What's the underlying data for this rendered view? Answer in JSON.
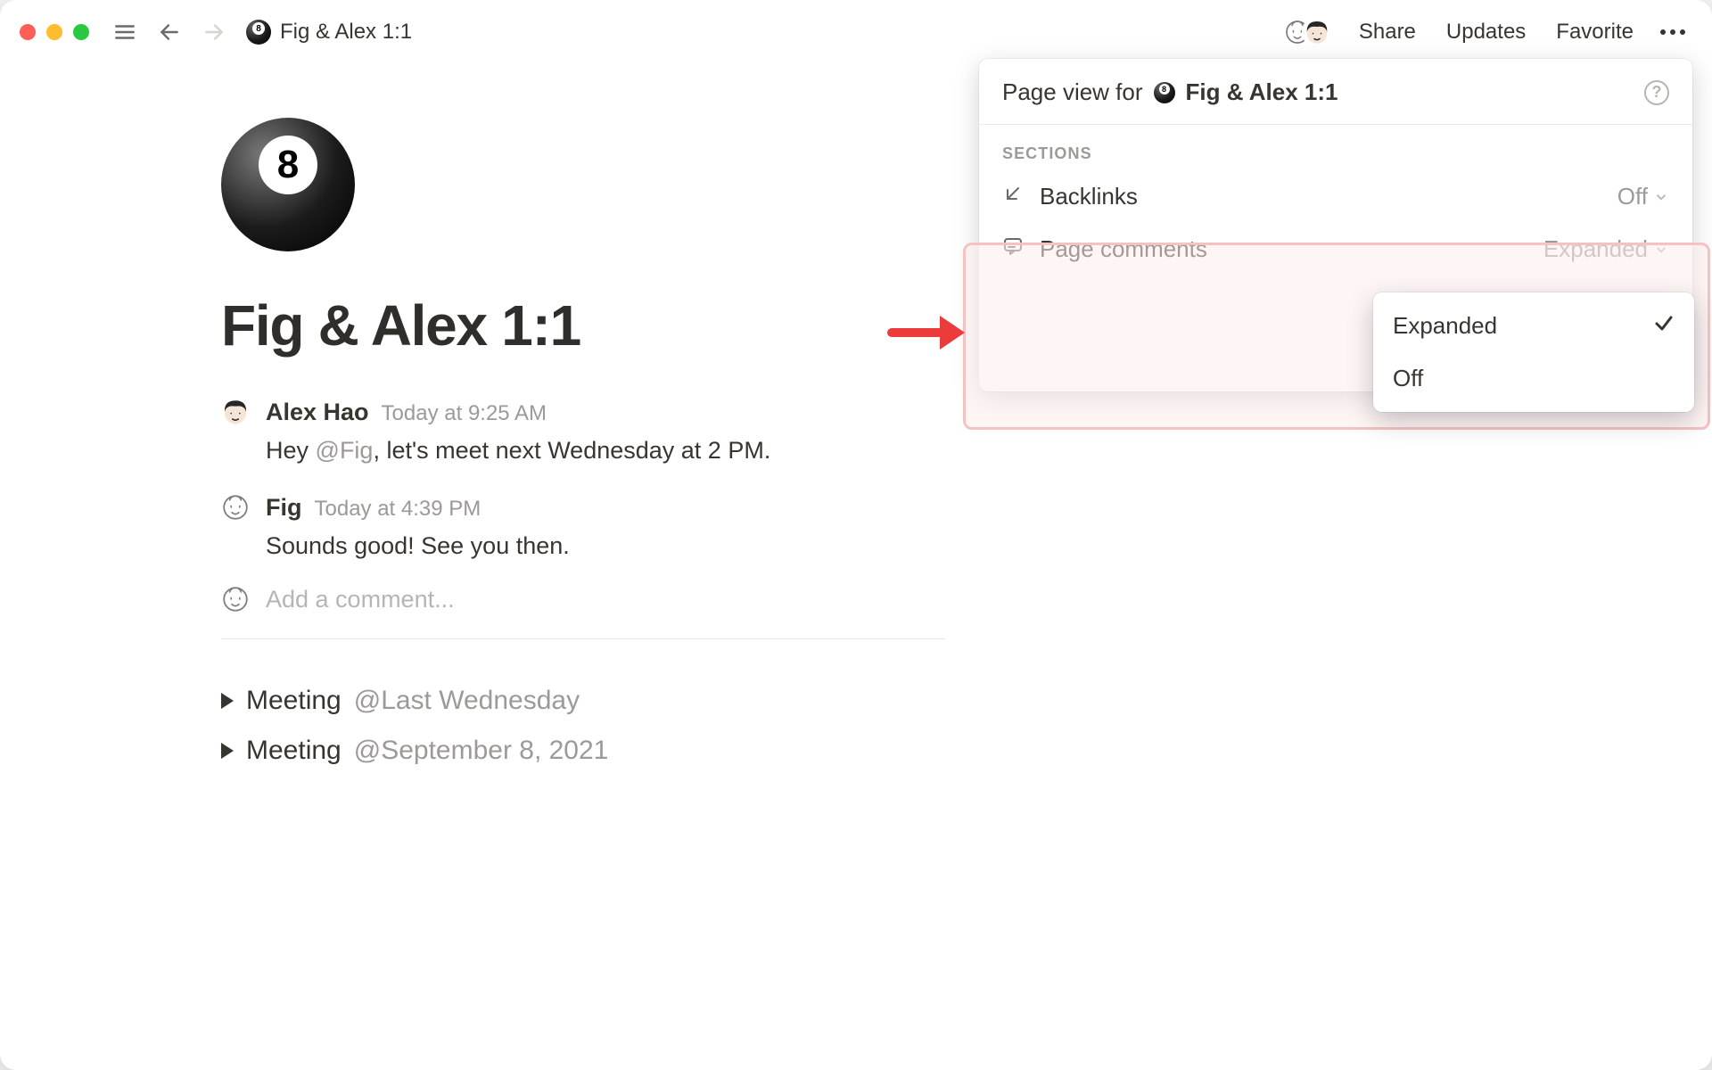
{
  "topbar": {
    "breadcrumb_title": "Fig & Alex 1:1",
    "links": {
      "share": "Share",
      "updates": "Updates",
      "favorite": "Favorite"
    }
  },
  "page": {
    "title": "Fig & Alex 1:1",
    "comments": [
      {
        "author": "Alex Hao",
        "time": "Today at 9:25 AM",
        "text_prefix": "Hey ",
        "mention": "@Fig",
        "text_suffix": ", let's meet next Wednesday at 2 PM."
      },
      {
        "author": "Fig",
        "time": "Today at 4:39 PM",
        "text": "Sounds good! See you then."
      }
    ],
    "add_comment_placeholder": "Add a comment...",
    "toggles": [
      {
        "label": "Meeting",
        "date": "@Last Wednesday"
      },
      {
        "label": "Meeting",
        "date": "@September 8, 2021"
      }
    ]
  },
  "panel": {
    "lead": "Page view for",
    "page_name": "Fig & Alex 1:1",
    "sections_label": "SECTIONS",
    "rows": {
      "backlinks": {
        "label": "Backlinks",
        "value": "Off"
      },
      "page_comments": {
        "label": "Page comments",
        "value": "Expanded"
      }
    },
    "submenu": {
      "expanded": "Expanded",
      "off": "Off",
      "selected": "Expanded"
    }
  }
}
